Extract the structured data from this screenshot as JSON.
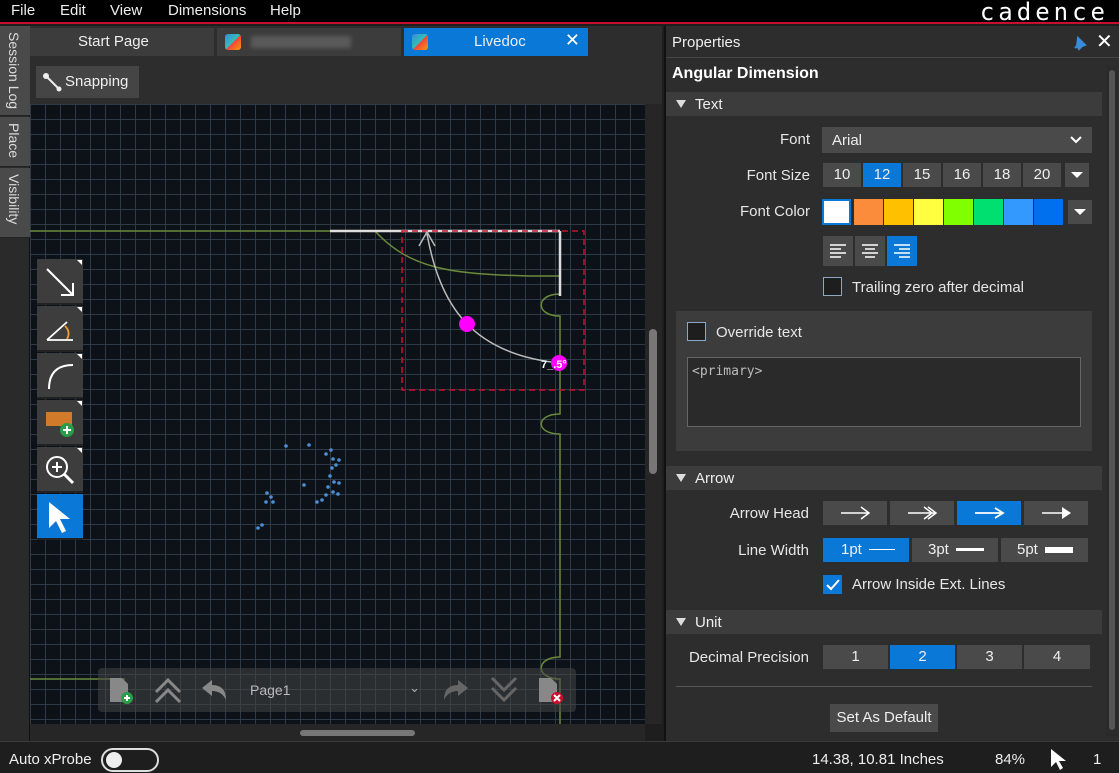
{
  "menu": {
    "items": [
      "File",
      "Edit",
      "View",
      "Dimensions",
      "Help"
    ],
    "brand": "cadence"
  },
  "side_tabs": [
    "Session Log",
    "Place",
    "Visibility"
  ],
  "tabs": [
    {
      "label": "Start Page",
      "active": false
    },
    {
      "label": "",
      "active": false
    },
    {
      "label": "Livedoc",
      "active": true
    }
  ],
  "toolbar": {
    "snapping_label": "Snapping"
  },
  "canvas": {
    "dimension_text": "7_.5°"
  },
  "vertical_tools": [
    "arrow-dimension-icon",
    "angular-dimension-icon",
    "arc-icon",
    "add-frame-icon",
    "zoom-in-icon",
    "select-pointer-icon"
  ],
  "page_nav": {
    "current_page": "Page1"
  },
  "properties": {
    "title": "Properties",
    "heading": "Angular Dimension",
    "text_section": {
      "label": "Text",
      "font_label": "Font",
      "font_value": "Arial",
      "font_size_label": "Font Size",
      "font_sizes": [
        "10",
        "12",
        "15",
        "16",
        "18",
        "20"
      ],
      "font_size_selected": "12",
      "font_color_label": "Font Color",
      "font_colors": [
        "#ffffff",
        "#fb8c3c",
        "#ffc000",
        "#ffff40",
        "#80ff00",
        "#00e070",
        "#3399ff",
        "#0070ee"
      ],
      "trailing_zero_label": "Trailing zero after decimal",
      "trailing_zero_checked": false,
      "override_label": "Override text",
      "override_checked": false,
      "override_value": "<primary>"
    },
    "arrow_section": {
      "label": "Arrow",
      "arrow_head_label": "Arrow Head",
      "arrow_head_selected": 2,
      "line_width_label": "Line Width",
      "line_widths": [
        "1pt",
        "3pt",
        "5pt"
      ],
      "line_width_selected": "1pt",
      "inside_ext_label": "Arrow Inside Ext. Lines",
      "inside_ext_checked": true
    },
    "unit_section": {
      "label": "Unit",
      "precision_label": "Decimal Precision",
      "precisions": [
        "1",
        "2",
        "3",
        "4"
      ],
      "precision_selected": "2"
    },
    "set_default_label": "Set As Default"
  },
  "status": {
    "auto_xprobe_label": "Auto xProbe",
    "auto_xprobe_on": false,
    "coordinates": "14.38, 10.81 Inches",
    "zoom": "84%",
    "selection_count": "1"
  }
}
